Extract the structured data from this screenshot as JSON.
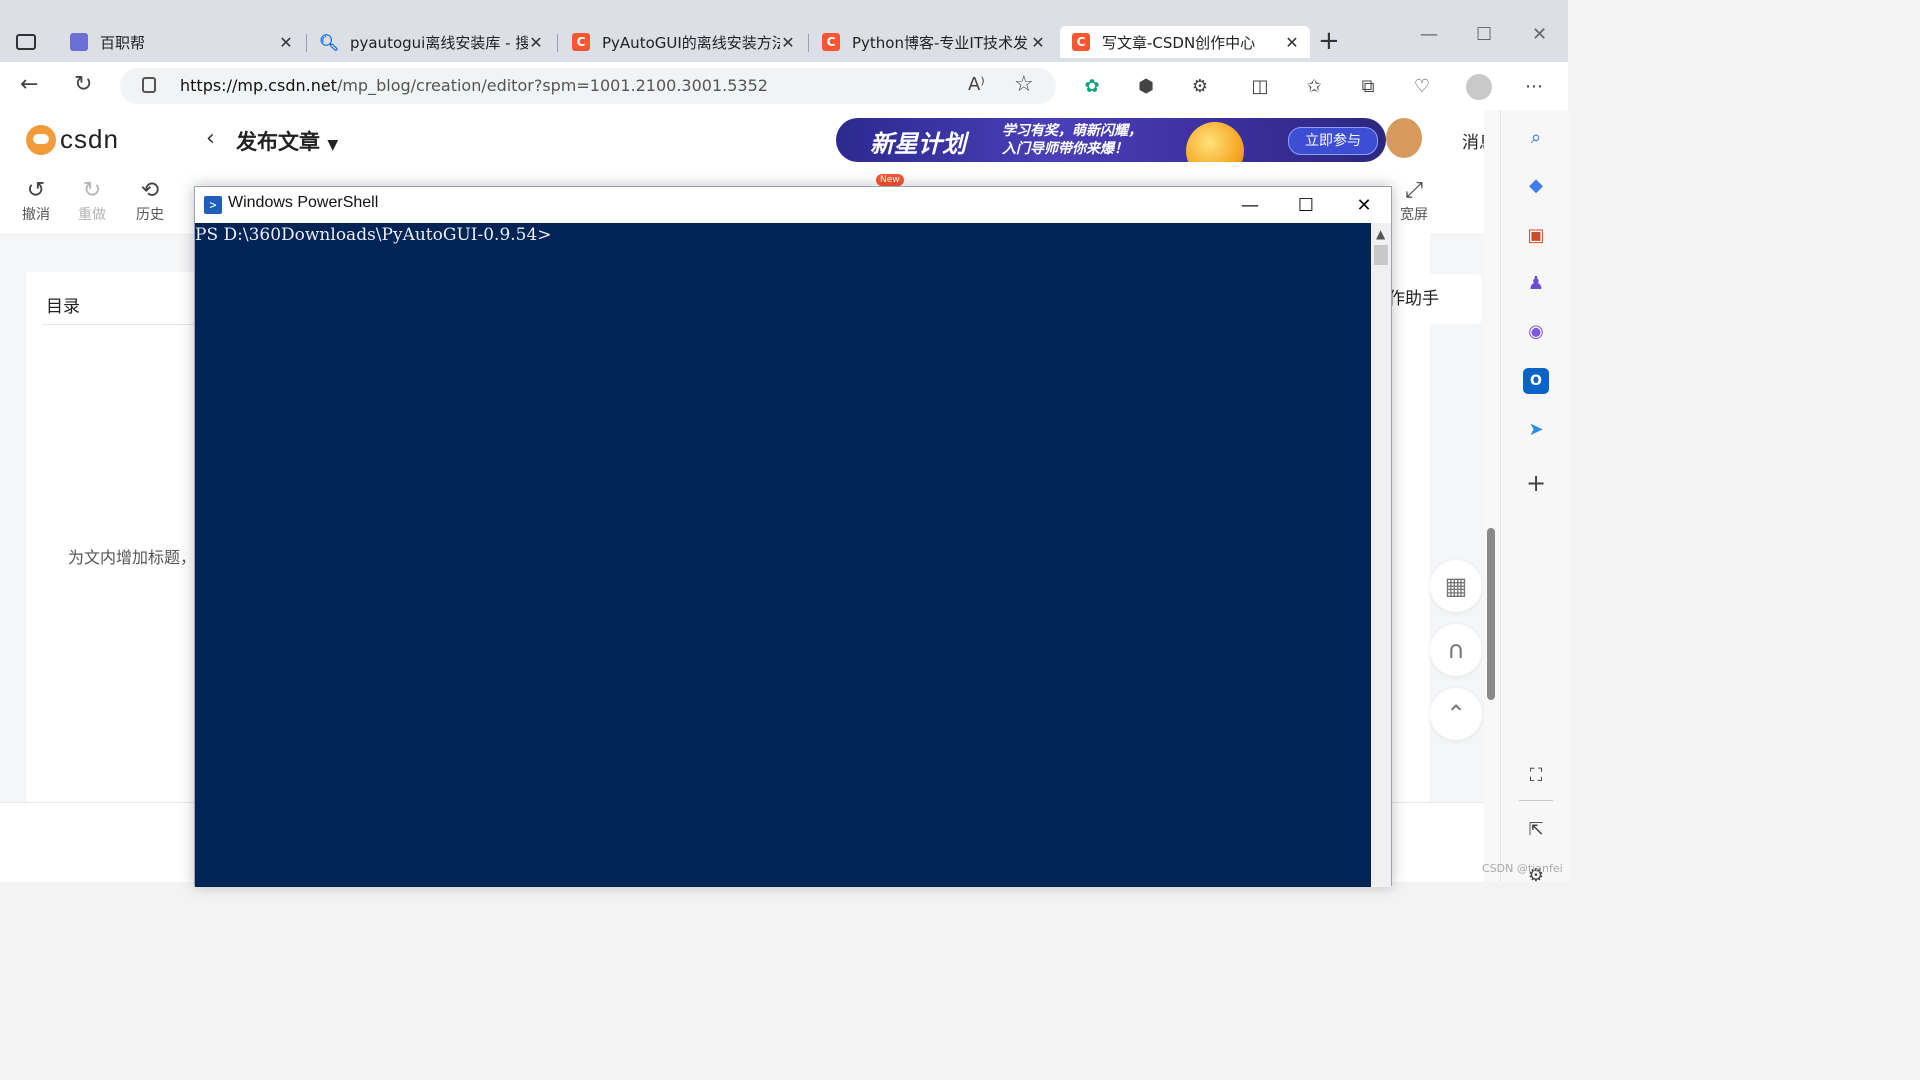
{
  "browser": {
    "tabs": [
      {
        "title": "百职帮",
        "favicon": "baizhibang-icon",
        "color": "#6b6fd6"
      },
      {
        "title": "pyautogui离线安装库 - 搜索",
        "favicon": "search-icon",
        "color": "#1a73e8"
      },
      {
        "title": "PyAutoGUI的离线安装方法",
        "favicon": "csdn-icon",
        "color": "#fc5531"
      },
      {
        "title": "Python博客-专业IT技术发",
        "favicon": "csdn-icon",
        "color": "#fc5531"
      },
      {
        "title": "写文章-CSDN创作中心",
        "favicon": "csdn-icon",
        "color": "#fc5531",
        "active": true
      }
    ],
    "url_host": "https://mp.csdn.net",
    "url_path": "/mp_blog/creation/editor?spm=1001.2100.3001.5352"
  },
  "csdn": {
    "logo": "csdn",
    "publish_title": "发布文章",
    "banner": {
      "headline": "新星计划",
      "line1": "学习有奖，萌新闪耀，",
      "line2": "入门导师带你来爆！",
      "button": "立即参与"
    },
    "message_label": "消息",
    "toolbar": {
      "undo": "撤消",
      "redo": "重做",
      "history": "历史",
      "wide": "宽屏",
      "new_badge": "New"
    },
    "toc_title": "目录",
    "toc_hint": "为文内增加标题，",
    "assistant": "作助手"
  },
  "powershell": {
    "title": "Windows PowerShell",
    "prompt": "PS D:\\360Downloads\\PyAutoGUI-0.9.54>",
    "background": "#012456"
  },
  "watermark": "CSDN @tianfei"
}
